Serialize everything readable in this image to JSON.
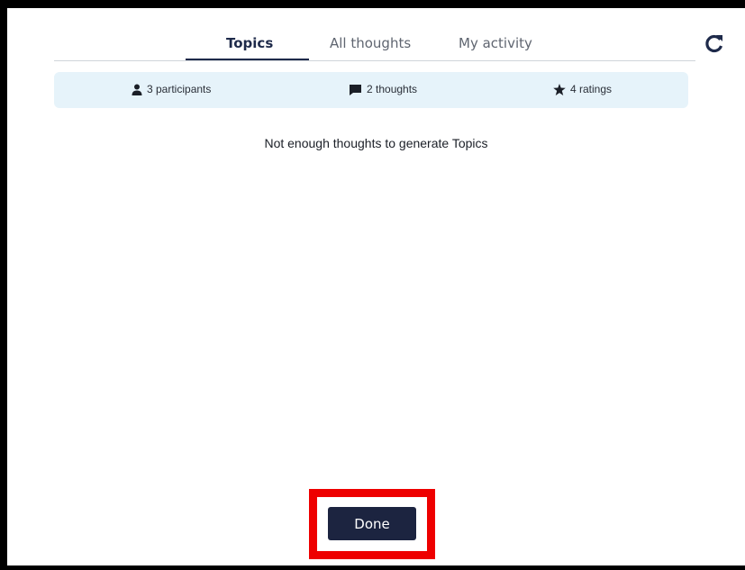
{
  "tabs": [
    {
      "label": "Topics",
      "active": true
    },
    {
      "label": "All thoughts",
      "active": false
    },
    {
      "label": "My activity",
      "active": false
    }
  ],
  "refresh": {
    "icon": "refresh-icon"
  },
  "stats": {
    "participants": {
      "icon": "user-icon",
      "label": "3 participants"
    },
    "thoughts": {
      "icon": "comment-icon",
      "label": "2 thoughts"
    },
    "ratings": {
      "icon": "star-icon",
      "label": "4 ratings"
    }
  },
  "main": {
    "empty_message": "Not enough thoughts to generate Topics"
  },
  "footer": {
    "done_label": "Done"
  },
  "colors": {
    "accent": "#1c2440",
    "stats_background": "#e6f3fa",
    "highlight_border": "#ee0000"
  }
}
